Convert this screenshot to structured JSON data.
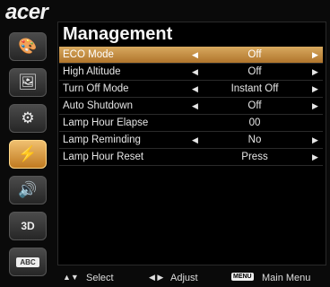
{
  "brand": "acer",
  "title": "Management",
  "sidebar": [
    {
      "name": "palette-icon",
      "glyph": "🎨"
    },
    {
      "name": "image-icon",
      "glyph": "🖼"
    },
    {
      "name": "gear-icon",
      "glyph": "⚙"
    },
    {
      "name": "management-icon",
      "glyph": "⚡"
    },
    {
      "name": "speaker-icon",
      "glyph": "🔊"
    },
    {
      "name": "3d-icon",
      "glyph": "3D"
    },
    {
      "name": "language-icon",
      "glyph": "ABC"
    }
  ],
  "items": [
    {
      "label": "ECO Mode",
      "value": "Off",
      "left": "◀",
      "right": "▶"
    },
    {
      "label": "High Altitude",
      "value": "Off",
      "left": "◀",
      "right": "▶"
    },
    {
      "label": "Turn Off Mode",
      "value": "Instant Off",
      "left": "◀",
      "right": "▶"
    },
    {
      "label": "Auto Shutdown",
      "value": "Off",
      "left": "◀",
      "right": "▶"
    },
    {
      "label": "Lamp Hour Elapse",
      "value": "00",
      "left": "",
      "right": ""
    },
    {
      "label": "Lamp Reminding",
      "value": "No",
      "left": "◀",
      "right": "▶"
    },
    {
      "label": "Lamp Hour Reset",
      "value": "Press",
      "left": "",
      "right": "▶"
    }
  ],
  "footer": {
    "select_arrows": "▲▼",
    "select_label": "Select",
    "adjust_arrows": "◀ ▶",
    "adjust_label": "Adjust",
    "menu_key": "MENU",
    "menu_label": "Main Menu"
  }
}
